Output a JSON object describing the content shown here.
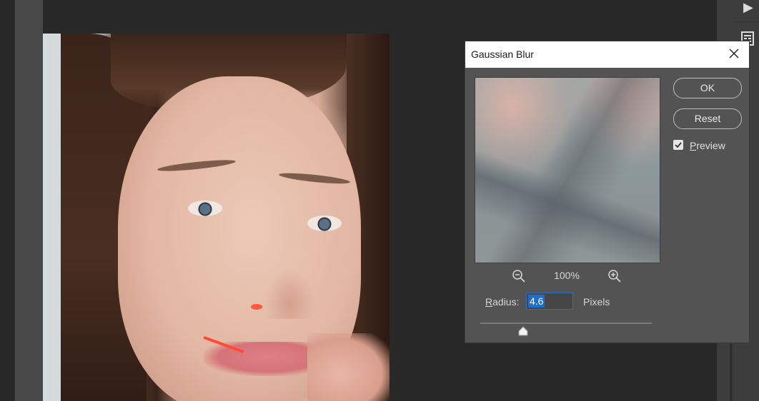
{
  "dialog": {
    "title": "Gaussian Blur",
    "close_icon": "close-icon",
    "zoom": {
      "level": "100%",
      "zoom_out_icon": "zoom-out-icon",
      "zoom_in_icon": "zoom-in-icon"
    },
    "radius": {
      "label": "Radius:",
      "value": "4.6",
      "units": "Pixels",
      "slider_position_fraction": 0.25
    },
    "buttons": {
      "ok_label": "OK",
      "reset_label": "Reset"
    },
    "preview": {
      "label": "Preview",
      "checked": true
    }
  },
  "right_strip": {
    "icons": [
      "play-icon",
      "panel-icon"
    ]
  },
  "colors": {
    "background": "#282828",
    "dialog_bg": "#535353",
    "accent": "#1a6fd1"
  }
}
